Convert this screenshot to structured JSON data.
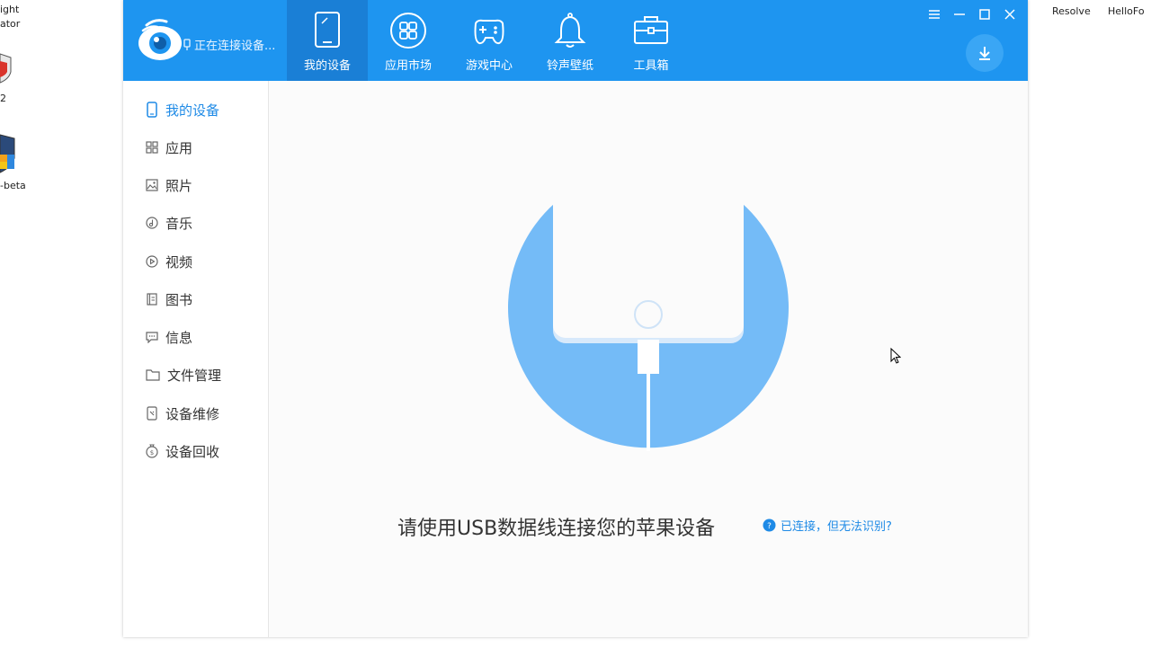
{
  "desktop": {
    "left_labels": [
      "ight",
      "ator",
      "2",
      "-beta"
    ],
    "right_labels": [
      "Resolve",
      "HelloFo"
    ]
  },
  "app": {
    "connection_status": "正在连接设备...",
    "nav_tabs": [
      {
        "label": "我的设备",
        "icon": "tablet-icon",
        "active": true
      },
      {
        "label": "应用市场",
        "icon": "apps-grid-icon",
        "active": false
      },
      {
        "label": "游戏中心",
        "icon": "gamepad-icon",
        "active": false
      },
      {
        "label": "铃声壁纸",
        "icon": "bell-icon",
        "active": false
      },
      {
        "label": "工具箱",
        "icon": "toolbox-icon",
        "active": false
      }
    ],
    "window_controls": [
      "menu-icon",
      "minimize-icon",
      "maximize-icon",
      "close-icon"
    ],
    "download_icon": "download-icon"
  },
  "sidebar": {
    "items": [
      {
        "label": "我的设备",
        "icon": "phone-icon",
        "active": true
      },
      {
        "label": "应用",
        "icon": "apps-icon",
        "active": false
      },
      {
        "label": "照片",
        "icon": "photo-icon",
        "active": false
      },
      {
        "label": "音乐",
        "icon": "music-icon",
        "active": false
      },
      {
        "label": "视频",
        "icon": "video-icon",
        "active": false
      },
      {
        "label": "图书",
        "icon": "book-icon",
        "active": false
      },
      {
        "label": "信息",
        "icon": "message-icon",
        "active": false
      },
      {
        "label": "文件管理",
        "icon": "folder-icon",
        "active": false
      },
      {
        "label": "设备维修",
        "icon": "repair-icon",
        "active": false
      },
      {
        "label": "设备回收",
        "icon": "recycle-icon",
        "active": false
      }
    ]
  },
  "main": {
    "connect_prompt": "请使用USB数据线连接您的苹果设备",
    "help_link": "已连接，但无法识别?"
  },
  "colors": {
    "topbar": "#1e95f0",
    "active_tab": "#1a7fd6",
    "accent": "#1e8ae6",
    "illustration": "#74bbf7"
  }
}
